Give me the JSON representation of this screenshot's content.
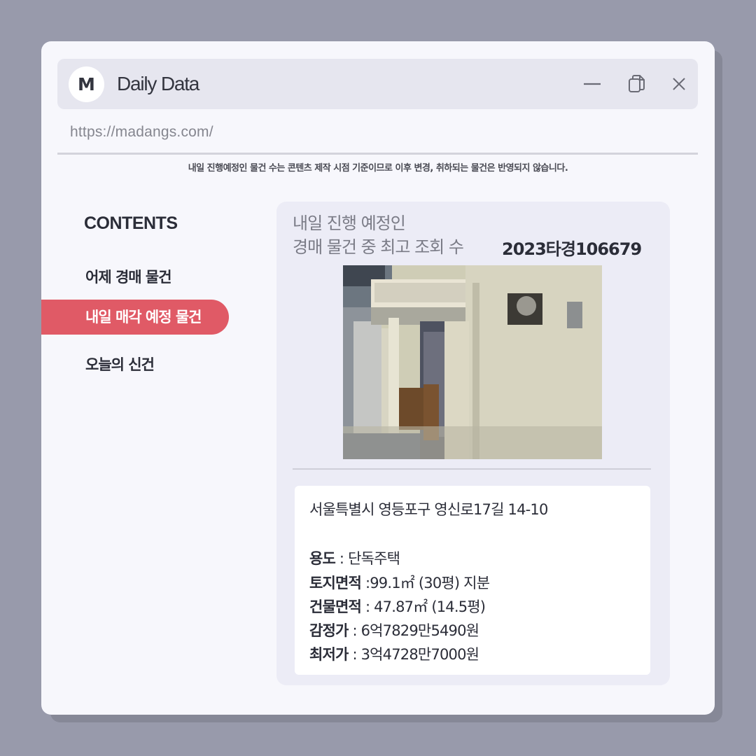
{
  "window": {
    "avatar_letter": "M",
    "title": "Daily Data",
    "controls": [
      "minimize-icon",
      "restore-icon",
      "close-icon"
    ]
  },
  "address_bar": {
    "url": "https://madangs.com/"
  },
  "notice": "내일 진행예정인 물건 수는 콘텐츠 제작 시점 기준이므로 이후 변경, 취하되는 물건은 반영되지 않습니다.",
  "sidebar": {
    "heading": "CONTENTS",
    "items": [
      {
        "label": "어제 경매 물건",
        "active": false
      },
      {
        "label": "내일 매각 예정 물건",
        "active": true
      },
      {
        "label": "오늘의 신건",
        "active": false
      }
    ]
  },
  "panel": {
    "title_line1": "내일 진행 예정인",
    "title_line2": "경매 물건 중 최고 조회 수",
    "case_number": "2023타경106679",
    "address": "서울특별시 영등포구 영신로17길 14-10",
    "fields": [
      {
        "key": "용도",
        "sep": " : ",
        "value": "단독주택"
      },
      {
        "key": "토지면적",
        "sep": " :",
        "value": "99.1㎡ (30평) 지분"
      },
      {
        "key": "건물면적",
        "sep": " : ",
        "value": "47.87㎡ (14.5평)"
      },
      {
        "key": "감정가",
        "sep": " : ",
        "value": "6억7829만5490원"
      },
      {
        "key": "최저가",
        "sep": " : ",
        "value": "3억4728만7000원"
      }
    ]
  },
  "colors": {
    "background": "#989aab",
    "window": "#f7f7fc",
    "titlebar": "#e6e6ef",
    "accent": "#e05a66",
    "panel": "#ececf6"
  }
}
